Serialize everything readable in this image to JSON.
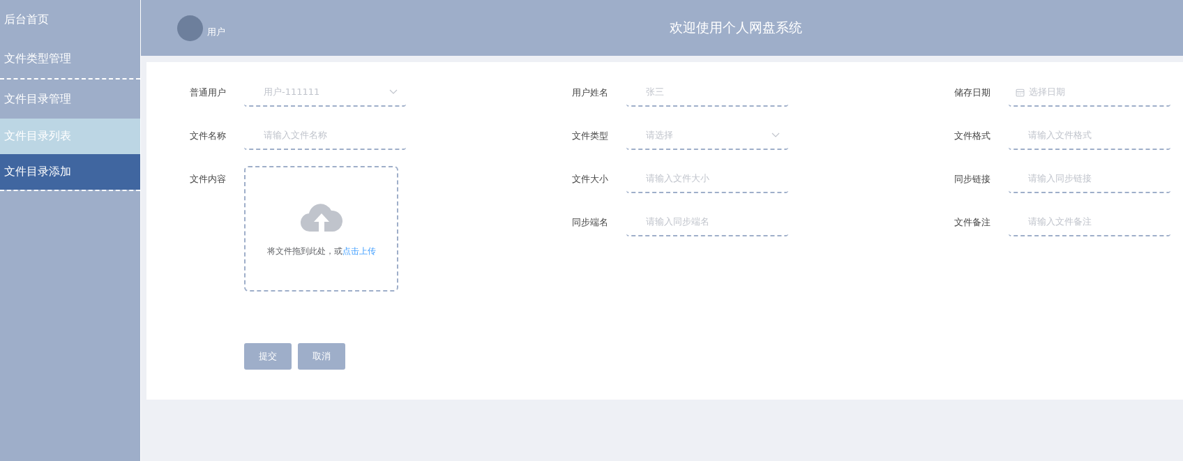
{
  "sidebar": {
    "groups": [
      {
        "items": [
          {
            "label": "后台首页",
            "selected": false,
            "highlighted": false
          },
          {
            "label": "文件类型管理",
            "selected": false,
            "highlighted": false
          }
        ]
      },
      {
        "items": [
          {
            "label": "文件目录管理",
            "selected": false,
            "highlighted": false
          },
          {
            "label": "文件目录列表",
            "selected": false,
            "highlighted": true
          },
          {
            "label": "文件目录添加",
            "selected": true,
            "highlighted": false
          }
        ]
      }
    ]
  },
  "header": {
    "user": "用户",
    "title": "欢迎使用个人网盘系统"
  },
  "form": {
    "columns": [
      {
        "fields": [
          {
            "kind": "select",
            "label": "普通用户",
            "value": "用户-111111",
            "disabled": true
          },
          {
            "kind": "input",
            "label": "文件名称",
            "placeholder": "请输入文件名称"
          },
          {
            "kind": "upload",
            "label": "文件内容",
            "hint": "将文件拖到此处，或",
            "link": "点击上传"
          }
        ]
      },
      {
        "fields": [
          {
            "kind": "input",
            "label": "用户姓名",
            "value": "张三",
            "disabled": true
          },
          {
            "kind": "select",
            "label": "文件类型",
            "placeholder": "请选择"
          },
          {
            "kind": "input",
            "label": "文件大小",
            "placeholder": "请输入文件大小"
          },
          {
            "kind": "input",
            "label": "同步端名",
            "placeholder": "请输入同步端名"
          }
        ]
      },
      {
        "fields": [
          {
            "kind": "date",
            "label": "储存日期",
            "placeholder": "选择日期"
          },
          {
            "kind": "input",
            "label": "文件格式",
            "placeholder": "请输入文件格式"
          },
          {
            "kind": "input",
            "label": "同步链接",
            "placeholder": "请输入同步链接"
          },
          {
            "kind": "input",
            "label": "文件备注",
            "placeholder": "请输入文件备注"
          }
        ]
      }
    ],
    "buttons": [
      "提交",
      "取消"
    ]
  }
}
